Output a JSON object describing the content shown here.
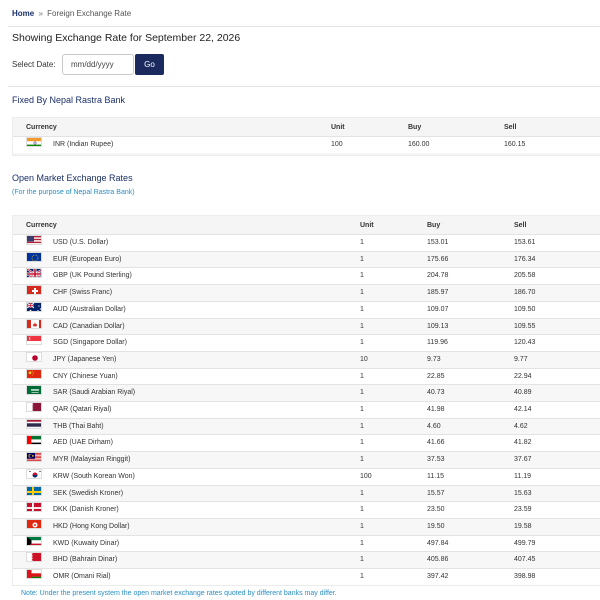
{
  "breadcrumb": {
    "home": "Home",
    "separator": "»",
    "current": "Foreign Exchange Rate"
  },
  "heading": "Showing Exchange Rate for September 22, 2026",
  "date_filter": {
    "label": "Select Date:",
    "placeholder": "mm/dd/yyyy",
    "button": "Go"
  },
  "nrb_section": {
    "title": "Fixed By Nepal Rastra Bank",
    "headers": {
      "currency": "Currency",
      "unit": "Unit",
      "buy": "Buy",
      "sell": "Sell"
    },
    "rows": [
      {
        "flag": "in",
        "currency": "INR (Indian Rupee)",
        "unit": "100",
        "buy": "160.00",
        "sell": "160.15"
      }
    ]
  },
  "open_market": {
    "title": "Open Market Exchange Rates",
    "subtitle": "(For the purpose of Nepal Rastra Bank)",
    "headers": {
      "currency": "Currency",
      "unit": "Unit",
      "buy": "Buy",
      "sell": "Sell"
    },
    "rows": [
      {
        "flag": "us",
        "currency": "USD (U.S. Dollar)",
        "unit": "1",
        "buy": "153.01",
        "sell": "153.61"
      },
      {
        "flag": "eu",
        "currency": "EUR (European Euro)",
        "unit": "1",
        "buy": "175.66",
        "sell": "176.34"
      },
      {
        "flag": "gb",
        "currency": "GBP (UK Pound Sterling)",
        "unit": "1",
        "buy": "204.78",
        "sell": "205.58"
      },
      {
        "flag": "ch",
        "currency": "CHF (Swiss Franc)",
        "unit": "1",
        "buy": "185.97",
        "sell": "186.70"
      },
      {
        "flag": "au",
        "currency": "AUD (Australian Dollar)",
        "unit": "1",
        "buy": "109.07",
        "sell": "109.50"
      },
      {
        "flag": "ca",
        "currency": "CAD (Canadian Dollar)",
        "unit": "1",
        "buy": "109.13",
        "sell": "109.55"
      },
      {
        "flag": "sg",
        "currency": "SGD (Singapore Dollar)",
        "unit": "1",
        "buy": "119.96",
        "sell": "120.43"
      },
      {
        "flag": "jp",
        "currency": "JPY (Japanese Yen)",
        "unit": "10",
        "buy": "9.73",
        "sell": "9.77"
      },
      {
        "flag": "cn",
        "currency": "CNY (Chinese Yuan)",
        "unit": "1",
        "buy": "22.85",
        "sell": "22.94"
      },
      {
        "flag": "sa",
        "currency": "SAR (Saudi Arabian Riyal)",
        "unit": "1",
        "buy": "40.73",
        "sell": "40.89"
      },
      {
        "flag": "qa",
        "currency": "QAR (Qatari Riyal)",
        "unit": "1",
        "buy": "41.98",
        "sell": "42.14"
      },
      {
        "flag": "th",
        "currency": "THB (Thai Baht)",
        "unit": "1",
        "buy": "4.60",
        "sell": "4.62"
      },
      {
        "flag": "ae",
        "currency": "AED (UAE Dirham)",
        "unit": "1",
        "buy": "41.66",
        "sell": "41.82"
      },
      {
        "flag": "my",
        "currency": "MYR (Malaysian Ringgit)",
        "unit": "1",
        "buy": "37.53",
        "sell": "37.67"
      },
      {
        "flag": "kr",
        "currency": "KRW (South Korean Won)",
        "unit": "100",
        "buy": "11.15",
        "sell": "11.19"
      },
      {
        "flag": "se",
        "currency": "SEK (Swedish Kroner)",
        "unit": "1",
        "buy": "15.57",
        "sell": "15.63"
      },
      {
        "flag": "dk",
        "currency": "DKK (Danish Kroner)",
        "unit": "1",
        "buy": "23.50",
        "sell": "23.59"
      },
      {
        "flag": "hk",
        "currency": "HKD (Hong Kong Dollar)",
        "unit": "1",
        "buy": "19.50",
        "sell": "19.58"
      },
      {
        "flag": "kw",
        "currency": "KWD (Kuwaity Dinar)",
        "unit": "1",
        "buy": "497.84",
        "sell": "499.79"
      },
      {
        "flag": "bh",
        "currency": "BHD (Bahrain Dinar)",
        "unit": "1",
        "buy": "405.86",
        "sell": "407.45"
      },
      {
        "flag": "om",
        "currency": "OMR (Omani Rial)",
        "unit": "1",
        "buy": "397.42",
        "sell": "398.98"
      }
    ]
  },
  "note": "Note: Under the present system the open market exchange rates quoted by different banks may differ.",
  "colors": {
    "navy": "#1b2a5e",
    "link_blue": "#2a8fc4",
    "table_bg": "#f5f5f5"
  }
}
